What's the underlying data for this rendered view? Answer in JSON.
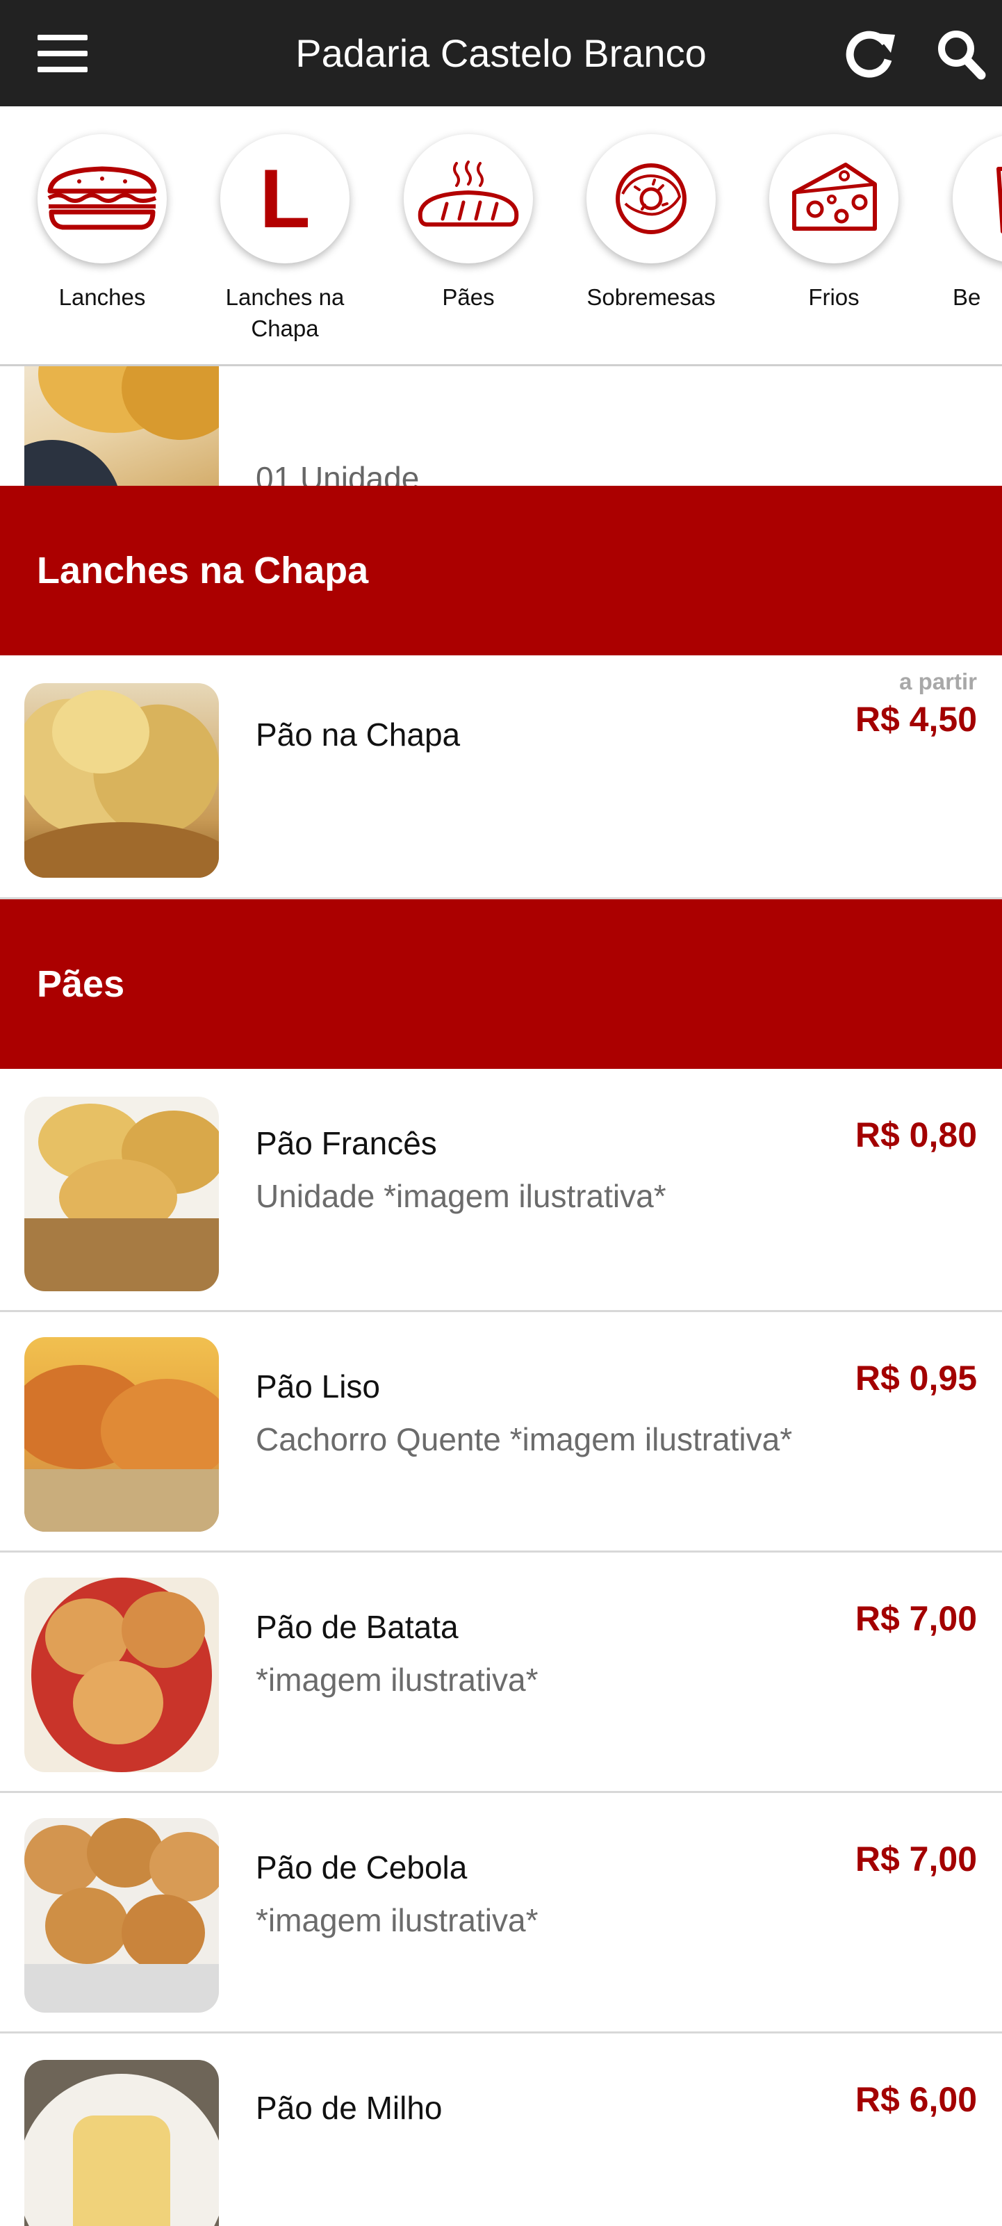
{
  "header": {
    "title": "Padaria Castelo Branco"
  },
  "categories": [
    {
      "label": "Lanches",
      "icon": "sandwich-icon"
    },
    {
      "label": "Lanches na Chapa",
      "icon_letter": "L"
    },
    {
      "label": "Pães",
      "icon": "bread-icon"
    },
    {
      "label": "Sobremesas",
      "icon": "donut-icon"
    },
    {
      "label": "Frios",
      "icon": "cheese-icon"
    },
    {
      "label": "Be",
      "icon": "drink-icon"
    }
  ],
  "partial_item": {
    "desc": "01 Unidade"
  },
  "sections": [
    {
      "title": "Lanches na Chapa",
      "items": [
        {
          "name": "Pão na Chapa",
          "from": "a partir",
          "price": "R$ 4,50"
        }
      ]
    },
    {
      "title": "Pães",
      "items": [
        {
          "name": "Pão Francês",
          "desc": "Unidade *imagem ilustrativa*",
          "price": "R$ 0,80"
        },
        {
          "name": "Pão Liso",
          "desc": "Cachorro Quente *imagem ilustrativa*",
          "price": "R$ 0,95"
        },
        {
          "name": "Pão de Batata",
          "desc": "*imagem ilustrativa*",
          "price": "R$ 7,00"
        },
        {
          "name": "Pão de Cebola",
          "desc": "*imagem ilustrativa*",
          "price": "R$ 7,00"
        },
        {
          "name": "Pão de Milho",
          "price": "R$ 6,00"
        }
      ]
    }
  ],
  "colors": {
    "header": "#222222",
    "brand_red": "#ab0000",
    "price_red": "#a30000"
  }
}
